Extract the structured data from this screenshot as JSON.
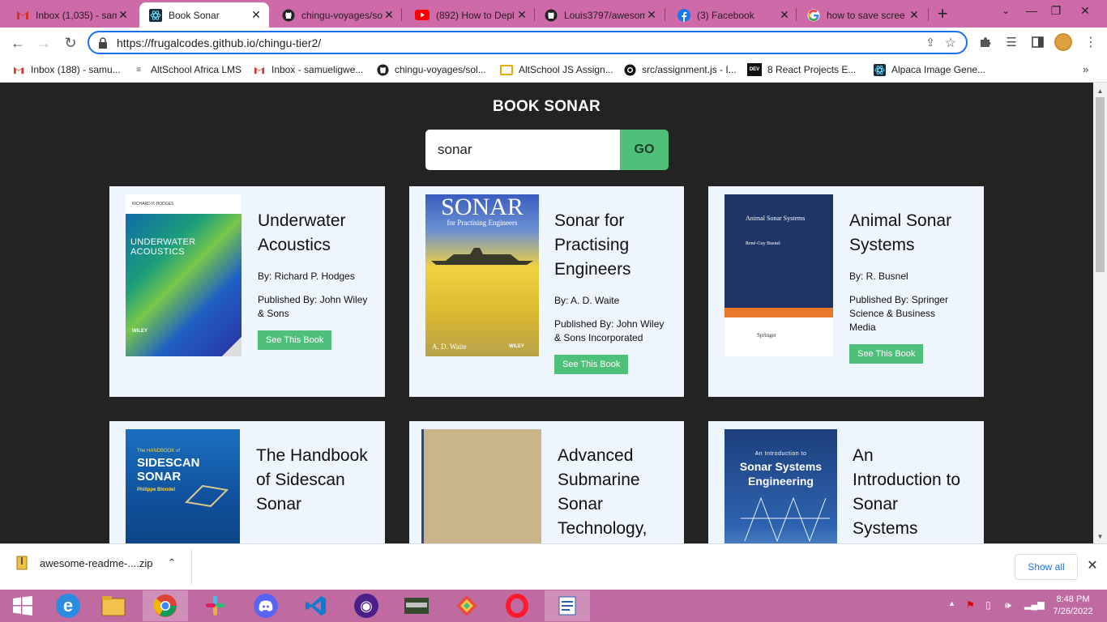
{
  "browser": {
    "tabs": [
      {
        "title": "Inbox (1,035) - sam",
        "icon": "gmail-icon",
        "active": false
      },
      {
        "title": "Book Sonar",
        "icon": "react-icon",
        "active": true
      },
      {
        "title": "chingu-voyages/so",
        "icon": "github-icon",
        "active": false
      },
      {
        "title": "(892) How to Depl",
        "icon": "youtube-icon",
        "active": false
      },
      {
        "title": "Louis3797/awesom",
        "icon": "github-icon",
        "active": false
      },
      {
        "title": "(3) Facebook",
        "icon": "facebook-icon",
        "active": false
      },
      {
        "title": "how to save scree",
        "icon": "google-icon",
        "active": false
      }
    ],
    "url": "https://frugalcodes.github.io/chingu-tier2/",
    "bookmarks": [
      {
        "label": "Inbox (188) - samu...",
        "icon": "gmail-icon"
      },
      {
        "label": "AltSchool Africa LMS",
        "icon": "altschool-icon"
      },
      {
        "label": "Inbox - samueligwe...",
        "icon": "gmail-icon"
      },
      {
        "label": "chingu-voyages/sol...",
        "icon": "github-icon"
      },
      {
        "label": "AltSchool JS Assign...",
        "icon": "folder-icon"
      },
      {
        "label": "src/assignment.js - I...",
        "icon": "replit-icon"
      },
      {
        "label": "8 React Projects E...",
        "icon": "dev-icon"
      },
      {
        "label": "Alpaca Image Gene...",
        "icon": "react-icon"
      }
    ]
  },
  "page": {
    "title": "BOOK SONAR",
    "search": {
      "value": "sonar",
      "placeholder": ""
    },
    "go_label": "GO",
    "books": [
      {
        "title": "Underwater Acoustics",
        "author": "By: Richard P. Hodges",
        "publisher": "Published By: John Wiley & Sons",
        "button": "See This Book",
        "cover_text": "UNDERWATER ACOUSTICS",
        "cover_author": "RICHARD P. HODGES",
        "cover_brand": "WILEY"
      },
      {
        "title": "Sonar for Practising Engineers",
        "author": "By: A. D. Waite",
        "publisher": "Published By: John Wiley & Sons Incorporated",
        "button": "See This Book",
        "cover_text": "SONAR",
        "cover_sub": "for Practising Engineers",
        "cover_author": "A. D. Waite",
        "cover_brand": "WILEY"
      },
      {
        "title": "Animal Sonar Systems",
        "author": "By: R. Busnel",
        "publisher": "Published By: Springer Science & Business Media",
        "button": "See This Book",
        "cover_text": "Animal Sonar Systems",
        "cover_author": "René-Guy Busnel",
        "cover_brand": "Springer"
      },
      {
        "title": "The Handbook of Sidescan Sonar",
        "cover_text": "SIDESCAN SONAR",
        "cover_sub": "The HANDBOOK of",
        "cover_author": "Philippe Blondel"
      },
      {
        "title": "Advanced Submarine Sonar Technology,"
      },
      {
        "title": "An Introduction to Sonar Systems",
        "cover_text": "Sonar Systems Engineering",
        "cover_sub": "An Introduction to"
      }
    ]
  },
  "download": {
    "filename": "awesome-readme-....zip",
    "show_all": "Show all"
  },
  "taskbar": {
    "time": "8:48 PM",
    "date": "7/26/2022"
  }
}
